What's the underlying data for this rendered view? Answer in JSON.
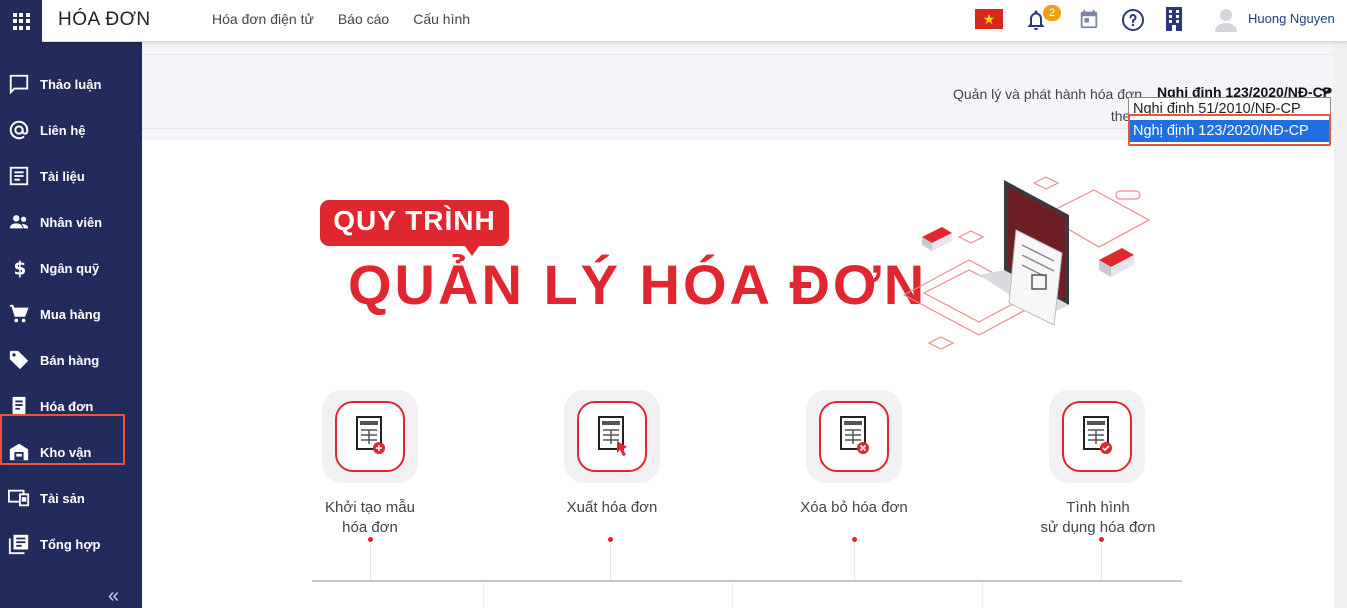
{
  "app": {
    "title": "HÓA ĐƠN",
    "nav": [
      "Hóa đơn điện tử",
      "Báo cáo",
      "Cấu hình"
    ],
    "notification_count": "2",
    "username": "Huong Nguyen"
  },
  "sidebar": {
    "items": [
      {
        "label": "Thảo luận",
        "icon": "chat-icon"
      },
      {
        "label": "Liên hệ",
        "icon": "at-icon"
      },
      {
        "label": "Tài liệu",
        "icon": "document-icon"
      },
      {
        "label": "Nhân viên",
        "icon": "people-icon"
      },
      {
        "label": "Ngân quỹ",
        "icon": "dollar-icon"
      },
      {
        "label": "Mua hàng",
        "icon": "cart-icon"
      },
      {
        "label": "Bán hàng",
        "icon": "tag-icon"
      },
      {
        "label": "Hóa đơn",
        "icon": "invoice-icon"
      },
      {
        "label": "Kho vận",
        "icon": "warehouse-icon"
      },
      {
        "label": "Tài sản",
        "icon": "devices-icon"
      },
      {
        "label": "Tổng hợp",
        "icon": "library-icon"
      }
    ],
    "active": "Hóa đơn",
    "collapse_glyph": "«"
  },
  "filter": {
    "label": "Quản lý và phát hành hóa đơn theo:",
    "selected": "Nghị định 123/2020/NĐ-CP",
    "options": [
      "Nghị định 51/2010/NĐ-CP",
      "Nghị định 123/2020/NĐ-CP"
    ],
    "highlighted_option": "Nghị định 123/2020/NĐ-CP"
  },
  "hero": {
    "badge": "QUY TRÌNH",
    "title": "QUẢN LÝ HÓA ĐƠN"
  },
  "steps": [
    {
      "line1": "Khởi tạo mẫu",
      "line2": "hóa đơn",
      "icon": "invoice-add-icon"
    },
    {
      "line1": "Xuất hóa đơn",
      "line2": "",
      "icon": "invoice-issue-icon"
    },
    {
      "line1": "Xóa bỏ hóa đơn",
      "line2": "",
      "icon": "invoice-delete-icon"
    },
    {
      "line1": "Tình hình",
      "line2": "sử dụng hóa đơn",
      "icon": "invoice-check-icon"
    }
  ],
  "colors": {
    "sidebar_bg": "#232a5c",
    "brand_red": "#e0262f",
    "highlight_border": "#e8543e",
    "select_highlight": "#1e6fe0"
  }
}
